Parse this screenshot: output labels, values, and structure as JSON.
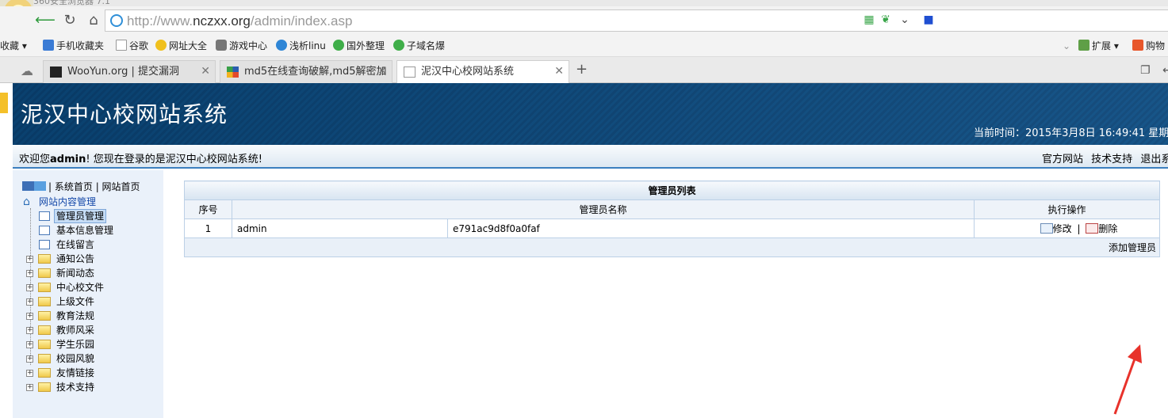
{
  "browser": {
    "window_title": "360安全浏览器 7.1",
    "url_prefix": "http://www.",
    "url_host": "nczxx.org",
    "url_path": "/admin/index.asp",
    "bookmarks": [
      "收藏",
      "手机收藏夹",
      "谷歌",
      "网址大全",
      "游戏中心",
      "浅析linu",
      "国外整理",
      "子域名爆"
    ],
    "bookmarks_right": [
      "扩展",
      "购物"
    ],
    "tabs": [
      {
        "title": "WooYun.org | 提交漏洞"
      },
      {
        "title": "md5在线查询破解,md5解密加"
      },
      {
        "title": "泥汉中心校网站系统"
      }
    ]
  },
  "site": {
    "title": "泥汉中心校网站系统",
    "time": "当前时间：2015年3月8日  16:49:41 星期",
    "welcome_prefix": "欢迎您",
    "welcome_user": "admin",
    "welcome_suffix": "! 您现在登录的是泥汉中心校网站系统!",
    "header_links": [
      "官方网站",
      "技术支持",
      "退出系"
    ]
  },
  "sidebar": {
    "home_link": "| 系统首页",
    "site_link": "| 网站首页",
    "root": "网站内容管理",
    "items": [
      {
        "label": "管理员管理",
        "type": "page",
        "selected": true
      },
      {
        "label": "基本信息管理",
        "type": "page"
      },
      {
        "label": "在线留言",
        "type": "page"
      },
      {
        "label": "通知公告",
        "type": "folder"
      },
      {
        "label": "新闻动态",
        "type": "folder"
      },
      {
        "label": "中心校文件",
        "type": "folder"
      },
      {
        "label": "上级文件",
        "type": "folder"
      },
      {
        "label": "教育法规",
        "type": "folder"
      },
      {
        "label": "教师风采",
        "type": "folder"
      },
      {
        "label": "学生乐园",
        "type": "folder"
      },
      {
        "label": "校园风貌",
        "type": "folder"
      },
      {
        "label": "友情链接",
        "type": "folder"
      },
      {
        "label": "技术支持",
        "type": "folder"
      }
    ]
  },
  "admin_table": {
    "caption": "管理员列表",
    "headers": [
      "序号",
      "管理员名称",
      "执行操作"
    ],
    "rows": [
      {
        "index": "1",
        "name": "admin",
        "hash": "e791ac9d8f0a0faf",
        "edit": "修改",
        "delete": "删除"
      }
    ],
    "add_label": "添加管理员"
  },
  "colors": {
    "header_blue": "#0b4c82",
    "sidebar_bg": "#eaf1fa",
    "arrow_red": "#e8322b"
  }
}
